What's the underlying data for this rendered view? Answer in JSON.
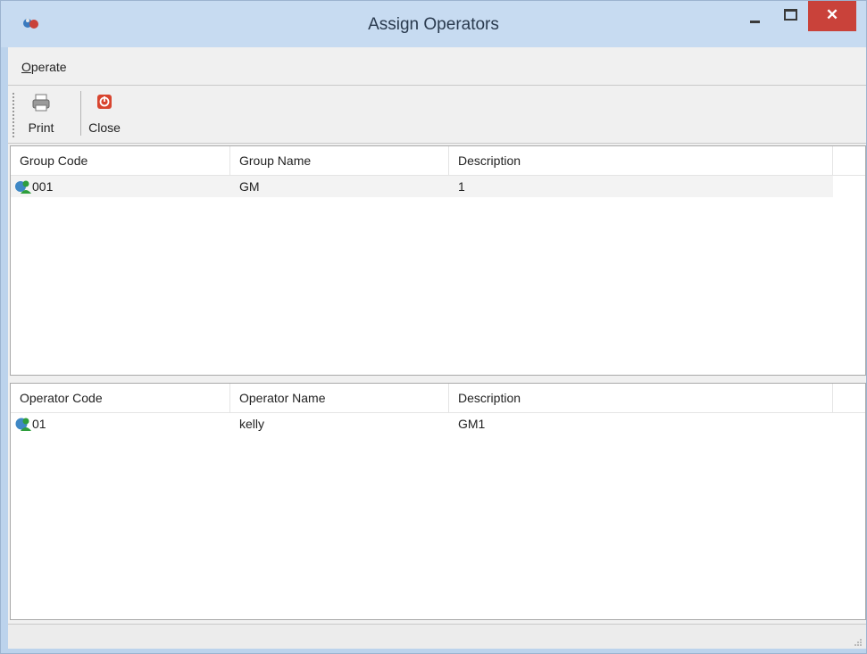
{
  "window": {
    "title": "Assign Operators",
    "close_glyph": "✕"
  },
  "menu": {
    "operate_first": "O",
    "operate_rest": "perate"
  },
  "toolbar": {
    "print_label": "Print",
    "close_label": "Close"
  },
  "groups": {
    "headers": [
      "Group Code",
      "Group Name",
      "Description"
    ],
    "rows": [
      {
        "code": "001",
        "name": "GM",
        "description": "1"
      }
    ]
  },
  "operators": {
    "headers": [
      "Operator Code",
      "Operator Name",
      "Description"
    ],
    "rows": [
      {
        "code": "01",
        "name": "kelly",
        "description": "GM1"
      }
    ]
  },
  "colors": {
    "close_red": "#c9423a",
    "title_bg": "#c7dbf1"
  }
}
